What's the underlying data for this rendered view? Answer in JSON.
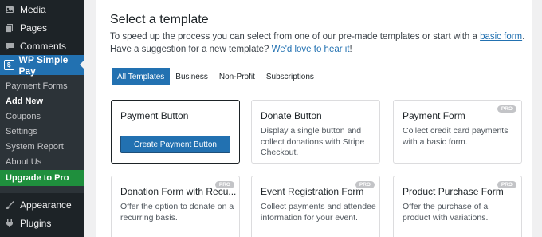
{
  "sidebar": {
    "top_items": [
      {
        "label": "Media"
      },
      {
        "label": "Pages"
      },
      {
        "label": "Comments"
      }
    ],
    "active_label": "WP Simple Pay",
    "submenu": [
      {
        "label": "Payment Forms"
      },
      {
        "label": "Add New"
      },
      {
        "label": "Coupons"
      },
      {
        "label": "Settings"
      },
      {
        "label": "System Report"
      },
      {
        "label": "About Us"
      },
      {
        "label": "Upgrade to Pro"
      }
    ],
    "bottom_items": [
      {
        "label": "Appearance"
      },
      {
        "label": "Plugins"
      }
    ]
  },
  "main": {
    "title": "Select a template",
    "desc_part1": "To speed up the process you can select from one of our pre-made templates or start with a ",
    "desc_link1": "basic form",
    "desc_part2": ". Have a suggestion for a new template? ",
    "desc_link2": "We'd love to hear it",
    "desc_part3": "!",
    "tabs": [
      {
        "label": "All Templates"
      },
      {
        "label": "Business"
      },
      {
        "label": "Non-Profit"
      },
      {
        "label": "Subscriptions"
      }
    ],
    "cards": [
      {
        "title": "Payment Button",
        "desc": "",
        "button": "Create Payment Button"
      },
      {
        "title": "Donate Button",
        "desc": "Display a single button and collect donations with Stripe Checkout."
      },
      {
        "title": "Payment Form",
        "desc": "Collect credit card payments with a basic form.",
        "badge": "PRO"
      },
      {
        "title": "Donation Form with Recu...",
        "desc": "Offer the option to donate on a recurring basis.",
        "badge": "PRO"
      },
      {
        "title": "Event Registration Form",
        "desc": "Collect payments and attendee information for your event.",
        "badge": "PRO"
      },
      {
        "title": "Product Purchase Form",
        "desc": "Offer the purchase of a product with variations.",
        "badge": "PRO"
      }
    ]
  },
  "colors": {
    "sidebar_bg": "#1d2327",
    "accent": "#2271b1",
    "upgrade": "#1f8f3d"
  }
}
